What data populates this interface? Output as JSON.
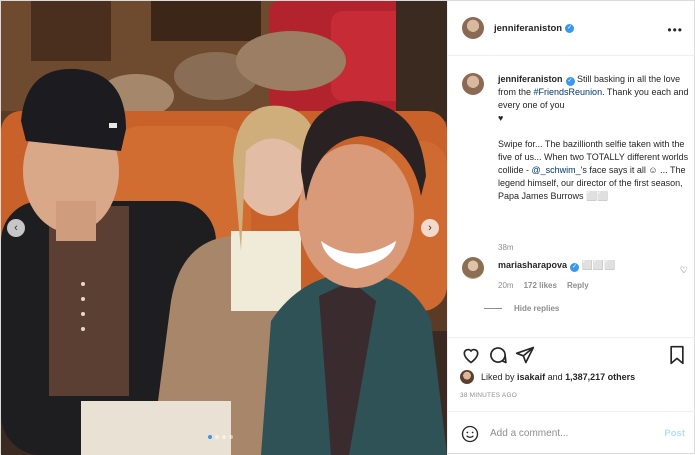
{
  "header": {
    "username": "jenniferaniston",
    "verified_icon": "verified-badge-icon",
    "more_icon": "more-options-icon"
  },
  "caption": {
    "username": "jenniferaniston",
    "text_before_tag": "Still basking in all the love from the",
    "hashtag": "#FriendsReunion",
    "text_after_tag": ". Thank you each and every one of you",
    "heart": "♥",
    "para2_before": "Swipe for... The bazillionth selfie taken with the five of us... When two TOTALLY different worlds collide - ",
    "mention": "@_schwim_",
    "para2_after": "'s face says it all ☺ ... The legend himself, our director of the first season, Papa James Burrows ⬜⬜",
    "time": "38m"
  },
  "reply": {
    "username": "mariasharapova",
    "text": "⬜⬜⬜",
    "time": "20m",
    "likes": "172 likes",
    "reply_label": "Reply",
    "hide_replies": "Hide replies"
  },
  "likes": {
    "prefix": "Liked by",
    "user": "isakaif",
    "and": "and",
    "count": "1,387,217 others"
  },
  "timestamp": "38 MINUTES AGO",
  "comment_box": {
    "placeholder": "Add a comment...",
    "post_label": "Post"
  },
  "carousel": {
    "prev": "‹",
    "next": "›",
    "slides": 4,
    "active_index": 0
  },
  "colors": {
    "link": "#00376b",
    "accent": "#3897f0",
    "post_disabled": "#b2dffc"
  }
}
